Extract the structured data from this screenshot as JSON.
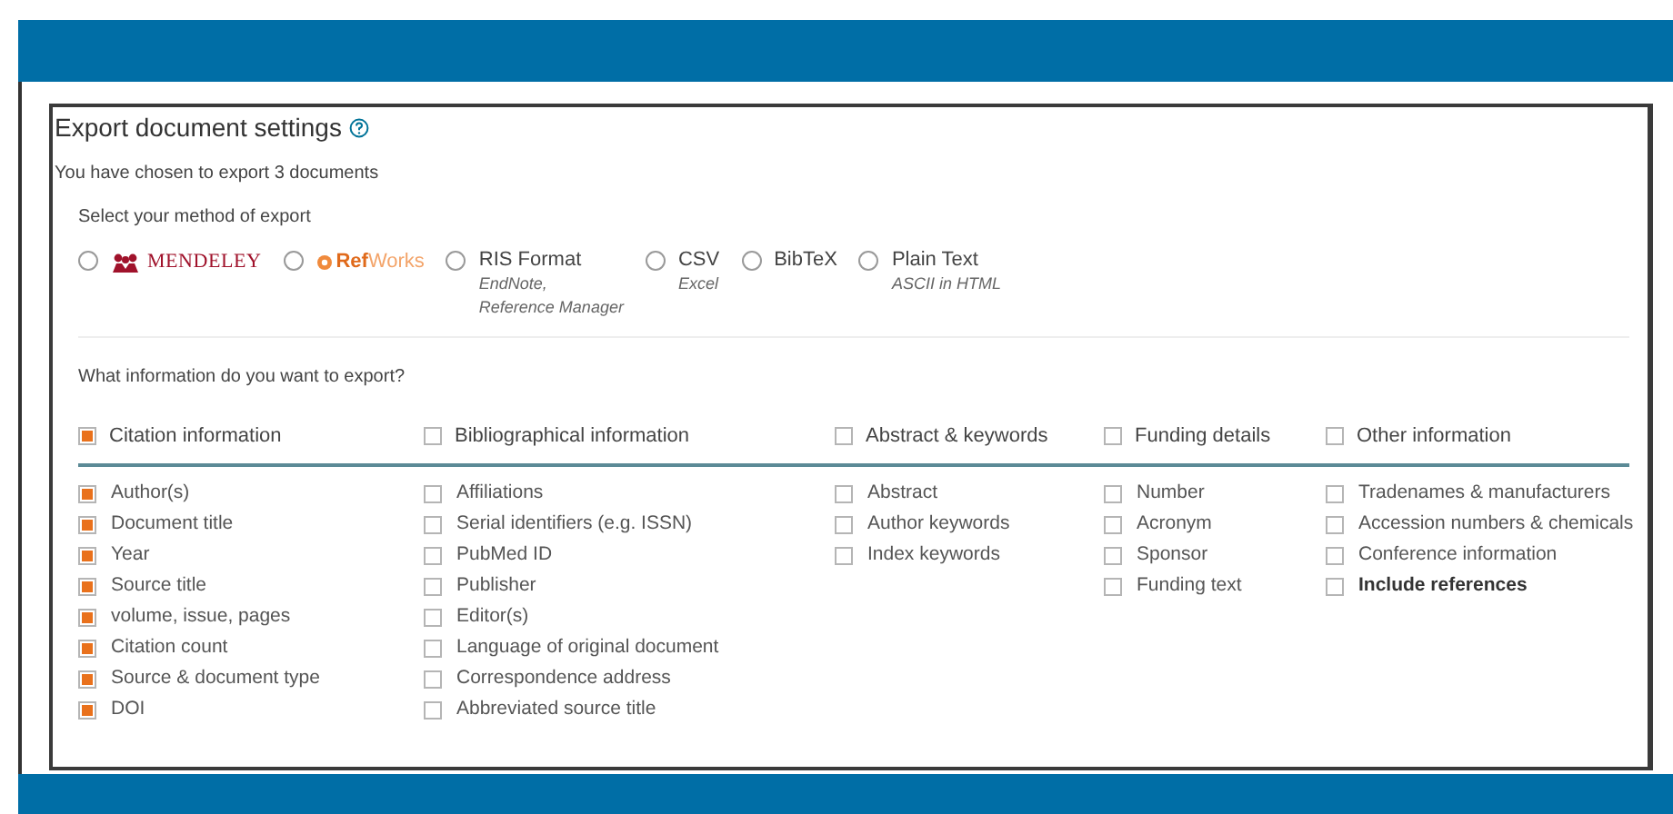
{
  "title": "Export document settings",
  "summary": "You have chosen to export 3 documents",
  "method_heading": "Select your method of export",
  "methods": [
    {
      "kind": "mendeley",
      "label": "MENDELEY",
      "selected": false
    },
    {
      "kind": "refworks",
      "label_parts": [
        "Ref",
        "Works"
      ],
      "selected": false
    },
    {
      "kind": "text",
      "label": "RIS Format",
      "notes": [
        "EndNote,",
        "Reference Manager"
      ],
      "selected": false
    },
    {
      "kind": "text",
      "label": "CSV",
      "notes": [
        "Excel"
      ],
      "selected": false
    },
    {
      "kind": "text",
      "label": "BibTeX",
      "selected": false
    },
    {
      "kind": "text",
      "label": "Plain Text",
      "notes": [
        "ASCII in HTML"
      ],
      "selected": false
    }
  ],
  "info_heading": "What information do you want to export?",
  "groups": [
    {
      "label": "Citation information",
      "checked": true,
      "items": [
        {
          "label": "Author(s)",
          "checked": true
        },
        {
          "label": "Document title",
          "checked": true
        },
        {
          "label": "Year",
          "checked": true
        },
        {
          "label": "Source title",
          "checked": true
        },
        {
          "label": "volume, issue, pages",
          "checked": true
        },
        {
          "label": "Citation count",
          "checked": true
        },
        {
          "label": "Source & document type",
          "checked": true
        },
        {
          "label": "DOI",
          "checked": true
        }
      ]
    },
    {
      "label": "Bibliographical information",
      "checked": false,
      "items": [
        {
          "label": "Affiliations",
          "checked": false
        },
        {
          "label": "Serial identifiers (e.g. ISSN)",
          "checked": false
        },
        {
          "label": "PubMed ID",
          "checked": false
        },
        {
          "label": "Publisher",
          "checked": false
        },
        {
          "label": "Editor(s)",
          "checked": false
        },
        {
          "label": "Language of original document",
          "checked": false
        },
        {
          "label": "Correspondence address",
          "checked": false
        },
        {
          "label": "Abbreviated source title",
          "checked": false
        }
      ]
    },
    {
      "label": "Abstract & keywords",
      "checked": false,
      "items": [
        {
          "label": "Abstract",
          "checked": false
        },
        {
          "label": "Author keywords",
          "checked": false
        },
        {
          "label": "Index keywords",
          "checked": false
        }
      ]
    },
    {
      "label": "Funding details",
      "checked": false,
      "items": [
        {
          "label": "Number",
          "checked": false
        },
        {
          "label": "Acronym",
          "checked": false
        },
        {
          "label": "Sponsor",
          "checked": false
        },
        {
          "label": "Funding text",
          "checked": false
        }
      ]
    },
    {
      "label": "Other information",
      "checked": false,
      "items": [
        {
          "label": "Tradenames & manufacturers",
          "checked": false
        },
        {
          "label": "Accession numbers & chemicals",
          "checked": false
        },
        {
          "label": "Conference information",
          "checked": false
        },
        {
          "label": "Include references",
          "checked": false,
          "bold": true
        }
      ]
    }
  ]
}
